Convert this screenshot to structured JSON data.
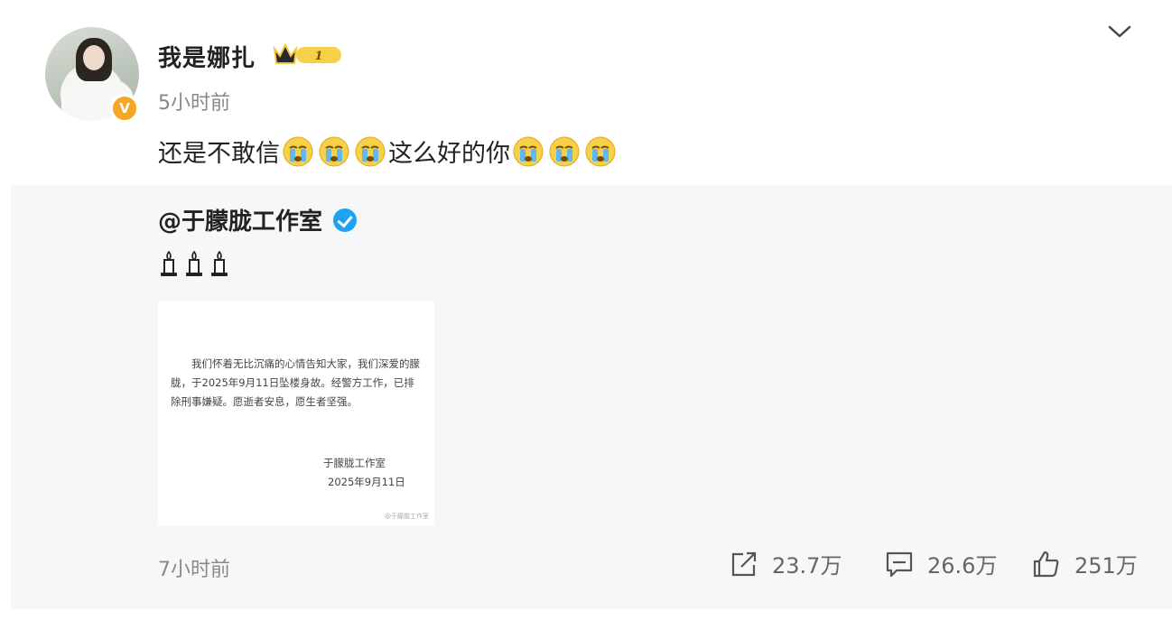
{
  "post": {
    "username": "我是娜扎",
    "vip_level": "1",
    "time": "5小时前",
    "text": "还是不敢信",
    "text_after": "这么好的你",
    "emoji_name": "crying-face-icon"
  },
  "repost": {
    "username": "@于朦胧工作室",
    "candles": "🕯🕯🕯",
    "notice": {
      "body": "我们怀着无比沉痛的心情告知大家，我们深爱的朦胧，于2025年9月11日坠楼身故。经警方工作，已排除刑事嫌疑。愿逝者安息，愿生者坚强。",
      "signature": "于朦胧工作室",
      "date": "2025年9月11日",
      "watermark": "@于朦胧工作室"
    },
    "time": "7小时前",
    "shares": "23.7万",
    "comments": "26.6万",
    "likes": "251万"
  },
  "colors": {
    "verified_orange": "#f5a623",
    "verified_blue": "#1da1f2",
    "gray_text": "#888888",
    "repost_bg": "#f6f7f8"
  }
}
